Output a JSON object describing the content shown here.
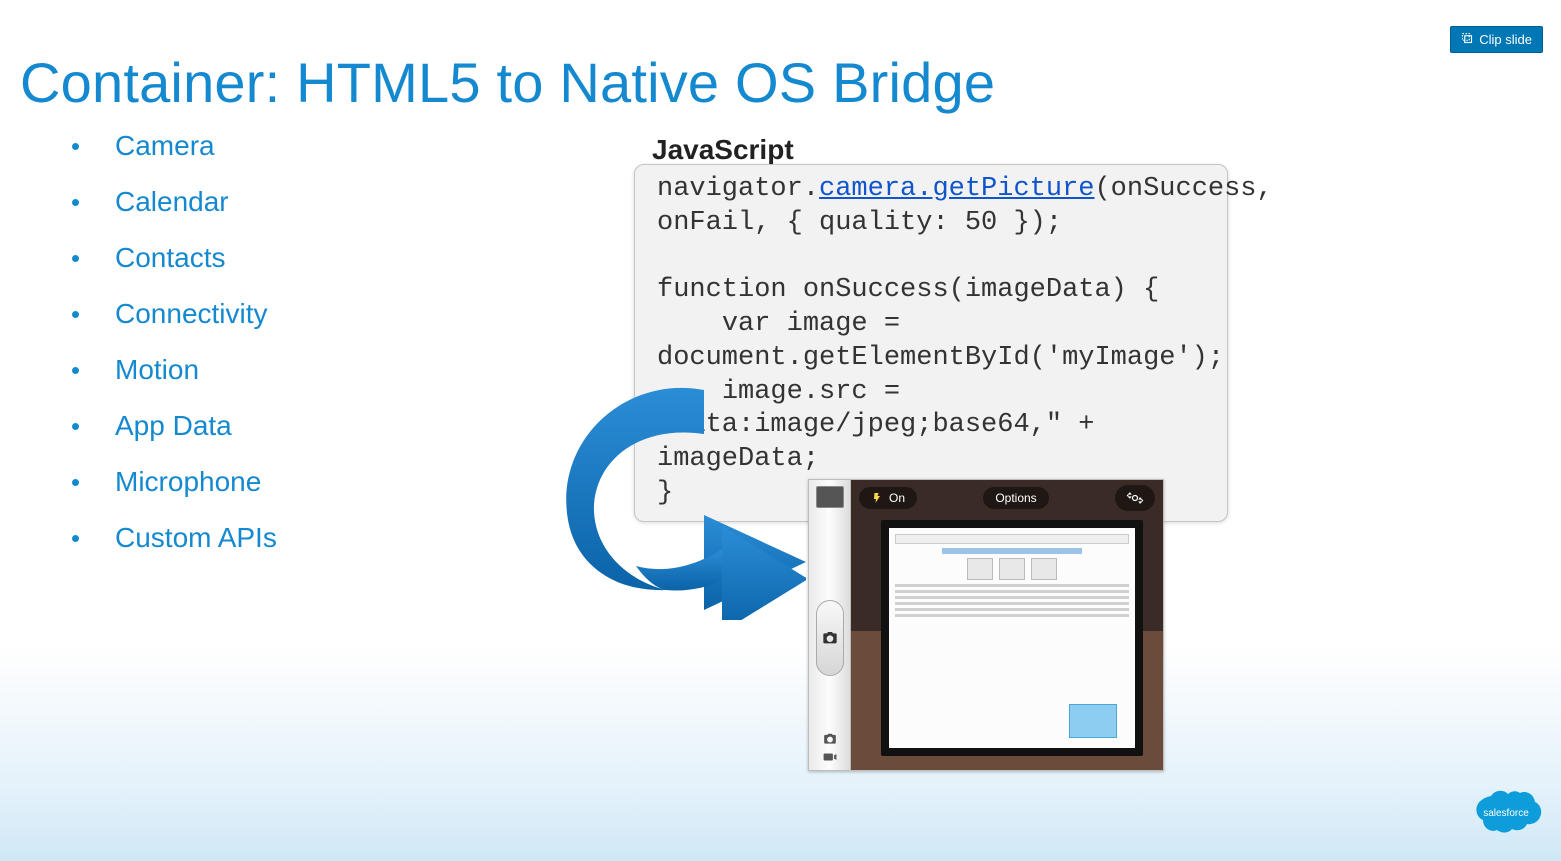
{
  "clip_button": "Clip slide",
  "title": "Container: HTML5 to Native OS Bridge",
  "features": [
    "Camera",
    "Calendar",
    "Contacts",
    "Connectivity",
    "Motion",
    "App Data",
    "Microphone",
    "Custom APIs"
  ],
  "js_label": "JavaScript",
  "code": {
    "prefix": "navigator.",
    "link": "camera.getPicture",
    "after_link": "(onSuccess, onFail, { quality: 50 });",
    "body": "function onSuccess(imageData) {\n    var image = document.getElementById('myImage');\n    image.src = \"data:image/jpeg;base64,\" + imageData;\n}"
  },
  "camera_ui": {
    "flash": "On",
    "options": "Options"
  },
  "brand": "salesforce"
}
